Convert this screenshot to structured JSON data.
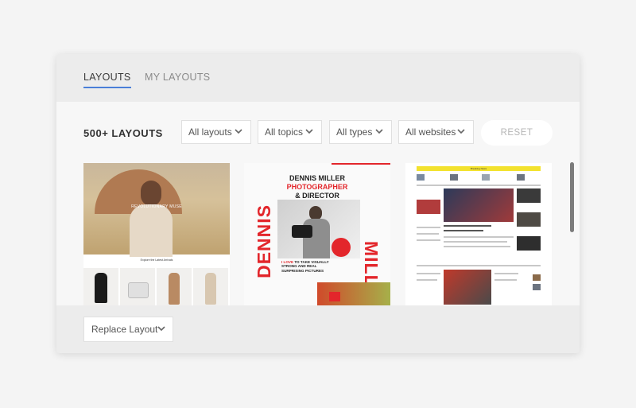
{
  "tabs": [
    {
      "label": "LAYOUTS",
      "active": true
    },
    {
      "label": "MY LAYOUTS",
      "active": false
    }
  ],
  "toolbar": {
    "count_label": "500+ LAYOUTS",
    "filters": [
      {
        "value": "All layouts"
      },
      {
        "value": "All topics"
      },
      {
        "value": "All types"
      },
      {
        "value": "All websites"
      }
    ],
    "reset_label": "RESET"
  },
  "thumbnails": [
    {
      "hero_title": "REVOLUTIONARY MUSE",
      "subtitle": "Explore the Latest Arrivals"
    },
    {
      "name_line1": "DENNIS MILLER",
      "name_line2": "PHOTOGRAPHER",
      "name_line3": "& DIRECTOR",
      "vertical_left": "DENNIS",
      "vertical_right": "MILLER",
      "tagline_highlight": "I LOVE",
      "tagline_rest": " TO TAKE VISUALLY STRONG AND REAL SURPRISING PICTURES"
    },
    {
      "banner_text": "Breaking News"
    }
  ],
  "footer": {
    "replace_label": "Replace Layout"
  },
  "colors": {
    "accent_tab": "#4a7fd8",
    "brand_red": "#e3262b",
    "banner_yellow": "#f3e22e"
  }
}
